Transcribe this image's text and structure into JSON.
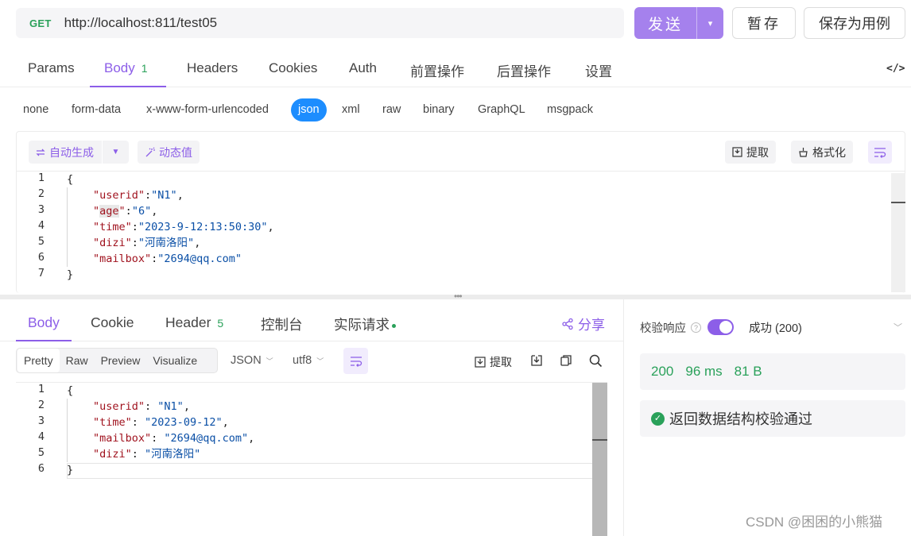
{
  "request": {
    "method": "GET",
    "url": "http://localhost:811/test05",
    "send_label": "发送",
    "save_label": "暂存",
    "save_case_label": "保存为用例"
  },
  "request_tabs": [
    {
      "label": "Params"
    },
    {
      "label": "Body",
      "count": "1"
    },
    {
      "label": "Headers"
    },
    {
      "label": "Cookies"
    },
    {
      "label": "Auth"
    },
    {
      "label": "前置操作"
    },
    {
      "label": "后置操作"
    },
    {
      "label": "设置"
    }
  ],
  "body_types": [
    "none",
    "form-data",
    "x-www-form-urlencoded",
    "json",
    "xml",
    "raw",
    "binary",
    "GraphQL",
    "msgpack"
  ],
  "editor_toolbar": {
    "auto_generate": "自动生成",
    "dynamic_value": "动态值",
    "extract": "提取",
    "format": "格式化"
  },
  "request_body_lines": [
    {
      "num": "1",
      "text": "{"
    },
    {
      "num": "2",
      "key": "\"userid\"",
      "value": "\"N1\"",
      "tail": ","
    },
    {
      "num": "3",
      "key_a": "\"",
      "key_mid": "age",
      "key_b": "\"",
      "value": "\"6\"",
      "tail": ","
    },
    {
      "num": "4",
      "key": "\"time\"",
      "value": "\"2023-9-12:13:50:30\"",
      "tail": ","
    },
    {
      "num": "5",
      "key": "\"dizi\"",
      "value": "\"河南洛阳\"",
      "tail": ","
    },
    {
      "num": "6",
      "key": "\"mailbox\"",
      "value": "\"2694@qq.com\"",
      "tail": ""
    },
    {
      "num": "7",
      "text": "}"
    }
  ],
  "response_tabs": [
    {
      "label": "Body"
    },
    {
      "label": "Cookie"
    },
    {
      "label": "Header",
      "count": "5"
    },
    {
      "label": "控制台"
    },
    {
      "label": "实际请求"
    }
  ],
  "share_label": "分享",
  "view_modes": [
    "Pretty",
    "Raw",
    "Preview",
    "Visualize"
  ],
  "format_select": "JSON",
  "encoding_select": "utf8",
  "response_extract": "提取",
  "response_body_lines": [
    {
      "num": "1",
      "text": "{"
    },
    {
      "num": "2",
      "key": "\"userid\"",
      "value": "\"N1\"",
      "tail": ","
    },
    {
      "num": "3",
      "key": "\"time\"",
      "value": "\"2023-09-12\"",
      "tail": ","
    },
    {
      "num": "4",
      "key": "\"mailbox\"",
      "value": "\"2694@qq.com\"",
      "tail": ","
    },
    {
      "num": "5",
      "key": "\"dizi\"",
      "value": "\"河南洛阳\"",
      "tail": ""
    },
    {
      "num": "6",
      "text": "}"
    }
  ],
  "validation": {
    "label": "校验响应",
    "enabled": true,
    "status": "成功 (200)",
    "status_code": "200",
    "time": "96 ms",
    "size": "81 B",
    "result": "返回数据结构校验通过"
  },
  "watermark": "CSDN @困困的小熊猫",
  "colors": {
    "accent": "#8c5ee8",
    "send_button": "#a581ed",
    "success": "#2aa15a",
    "json_active": "#1d8dfe",
    "json_key": "#a0121e",
    "json_string": "#0a4fa6"
  }
}
